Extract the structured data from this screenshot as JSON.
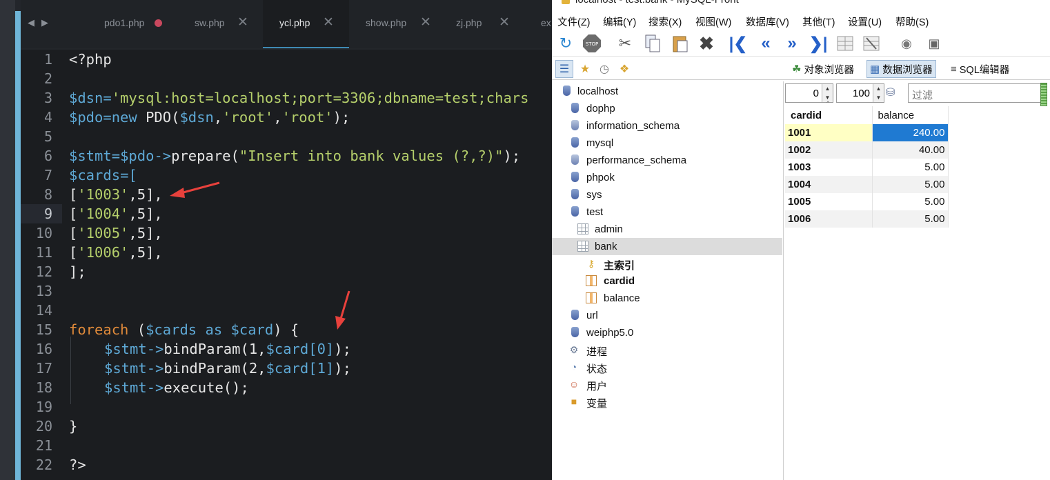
{
  "editor": {
    "tabs": [
      {
        "label": "pdo1.php",
        "state": "modified"
      },
      {
        "label": "sw.php",
        "state": "closable"
      },
      {
        "label": "ycl.php",
        "state": "active"
      },
      {
        "label": "show.php",
        "state": "closable"
      },
      {
        "label": "zj.php",
        "state": "closable"
      },
      {
        "label": "ex",
        "state": "truncated"
      }
    ],
    "close_glyph": "✕",
    "nav_back": "◀",
    "nav_forward": "▶",
    "current_line": 9,
    "lines": [
      {
        "n": "1"
      },
      {
        "n": "2"
      },
      {
        "n": "3"
      },
      {
        "n": "4"
      },
      {
        "n": "5"
      },
      {
        "n": "6"
      },
      {
        "n": "7"
      },
      {
        "n": "8"
      },
      {
        "n": "9"
      },
      {
        "n": "10"
      },
      {
        "n": "11"
      },
      {
        "n": "12"
      },
      {
        "n": "13"
      },
      {
        "n": "14"
      },
      {
        "n": "15"
      },
      {
        "n": "16"
      },
      {
        "n": "17"
      },
      {
        "n": "18"
      },
      {
        "n": "19"
      },
      {
        "n": "20"
      },
      {
        "n": "21"
      },
      {
        "n": "22"
      }
    ],
    "code": {
      "l1_open": "<?php",
      "l3_var": "$dsn",
      "l3_eq": "=",
      "l3_str": "'mysql:host=localhost;port=3306;dbname=test;chars",
      "l4_var": "$pdo",
      "l4_eq": "=",
      "l4_kw": "new",
      "l4_rest1": " PDO(",
      "l4_var2": "$dsn",
      "l4_comma": ",",
      "l4_str1": "'root'",
      "l4_comma2": ",",
      "l4_str2": "'root'",
      "l4_end": ");",
      "l6_var": "$stmt",
      "l6_eq": "=",
      "l6_var2": "$pdo",
      "l6_arrow": "->",
      "l6_fn": "prepare(",
      "l6_str": "\"Insert into bank values (?,?)\"",
      "l6_end": ");",
      "l7_var": "$cards",
      "l7_rest": "=[",
      "l8_a": "[",
      "l8_s": "'1003'",
      "l8_b": ",5],",
      "l9_a": "[",
      "l9_s": "'1004'",
      "l9_b": ",5],",
      "l10_a": "[",
      "l10_s": "'1005'",
      "l10_b": ",5],",
      "l11_a": "[",
      "l11_s": "'1006'",
      "l11_b": ",5],",
      "l12": "];",
      "l15_kw": "foreach",
      "l15_a": " (",
      "l15_var": "$cards",
      "l15_as": " as ",
      "l15_var2": "$card",
      "l15_b": ") {",
      "l16_var": "$stmt",
      "l16_arrow": "->",
      "l16_fn": "bindParam(1,",
      "l16_var2": "$card",
      "l16_idx": "[0]",
      "l16_end": ");",
      "l17_var": "$stmt",
      "l17_arrow": "->",
      "l17_fn": "bindParam(2,",
      "l17_var2": "$card",
      "l17_idx": "[1]",
      "l17_end": ");",
      "l18_var": "$stmt",
      "l18_arrow": "->",
      "l18_fn": "execute();",
      "l20": "}",
      "l22": "?>"
    },
    "colors": {
      "variable": "#5ea9d6",
      "string": "#b5cf6b",
      "keyword": "#e08a3a",
      "annotation_arrow": "#e8413c"
    }
  },
  "mysqlfront": {
    "title": "localhost - test.bank - MySQL-Front",
    "menu": [
      "文件(Z)",
      "编辑(Y)",
      "搜索(X)",
      "视图(W)",
      "数据库(V)",
      "其他(T)",
      "设置(U)",
      "帮助(S)"
    ],
    "toolbar_icons": [
      "refresh-icon",
      "stop-icon",
      "cut-icon",
      "copy-icon",
      "paste-icon",
      "delete-icon",
      "first-record-icon",
      "prev-page-icon",
      "next-page-icon",
      "last-record-icon",
      "insert-record-icon",
      "delete-record-icon",
      "post-icon",
      "cancel-icon"
    ],
    "toolbar2_icons": [
      "tree-view-icon",
      "favorites-icon",
      "history-icon",
      "files-icon"
    ],
    "view_tabs": [
      {
        "label": "对象浏览器",
        "active": false
      },
      {
        "label": "数据浏览器",
        "active": true
      },
      {
        "label": "SQL编辑器",
        "active": false
      }
    ],
    "tree": [
      {
        "label": "localhost",
        "icon": "server",
        "level": 0,
        "bold": false,
        "selected": false
      },
      {
        "label": "dophp",
        "icon": "database",
        "level": 1,
        "bold": false,
        "selected": false
      },
      {
        "label": "information_schema",
        "icon": "system-database",
        "level": 1,
        "bold": false,
        "selected": false
      },
      {
        "label": "mysql",
        "icon": "database",
        "level": 1,
        "bold": false,
        "selected": false
      },
      {
        "label": "performance_schema",
        "icon": "system-database",
        "level": 1,
        "bold": false,
        "selected": false
      },
      {
        "label": "phpok",
        "icon": "database",
        "level": 1,
        "bold": false,
        "selected": false
      },
      {
        "label": "sys",
        "icon": "database",
        "level": 1,
        "bold": false,
        "selected": false
      },
      {
        "label": "test",
        "icon": "database",
        "level": 1,
        "bold": false,
        "selected": false
      },
      {
        "label": "admin",
        "icon": "table",
        "level": 2,
        "bold": false,
        "selected": false
      },
      {
        "label": "bank",
        "icon": "table",
        "level": 2,
        "bold": false,
        "selected": true
      },
      {
        "label": "主索引",
        "icon": "key",
        "level": 3,
        "bold": true,
        "selected": false
      },
      {
        "label": "cardid",
        "icon": "column",
        "level": 3,
        "bold": true,
        "selected": false
      },
      {
        "label": "balance",
        "icon": "column",
        "level": 3,
        "bold": false,
        "selected": false
      },
      {
        "label": "url",
        "icon": "database",
        "level": 1,
        "bold": false,
        "selected": false
      },
      {
        "label": "weiphp5.0",
        "icon": "database",
        "level": 1,
        "bold": false,
        "selected": false
      },
      {
        "label": "进程",
        "icon": "processes",
        "level": 1,
        "bold": false,
        "selected": false
      },
      {
        "label": "状态",
        "icon": "status",
        "level": 1,
        "bold": false,
        "selected": false
      },
      {
        "label": "用户",
        "icon": "users",
        "level": 1,
        "bold": false,
        "selected": false
      },
      {
        "label": "变量",
        "icon": "variables",
        "level": 1,
        "bold": false,
        "selected": false
      }
    ],
    "pager": {
      "offset": "0",
      "limit": "100",
      "filter_placeholder": "过滤"
    },
    "grid": {
      "columns": [
        "cardid",
        "balance"
      ],
      "rows": [
        [
          "1001",
          "240.00"
        ],
        [
          "1002",
          "40.00"
        ],
        [
          "1003",
          "5.00"
        ],
        [
          "1004",
          "5.00"
        ],
        [
          "1005",
          "5.00"
        ],
        [
          "1006",
          "5.00"
        ]
      ]
    }
  }
}
